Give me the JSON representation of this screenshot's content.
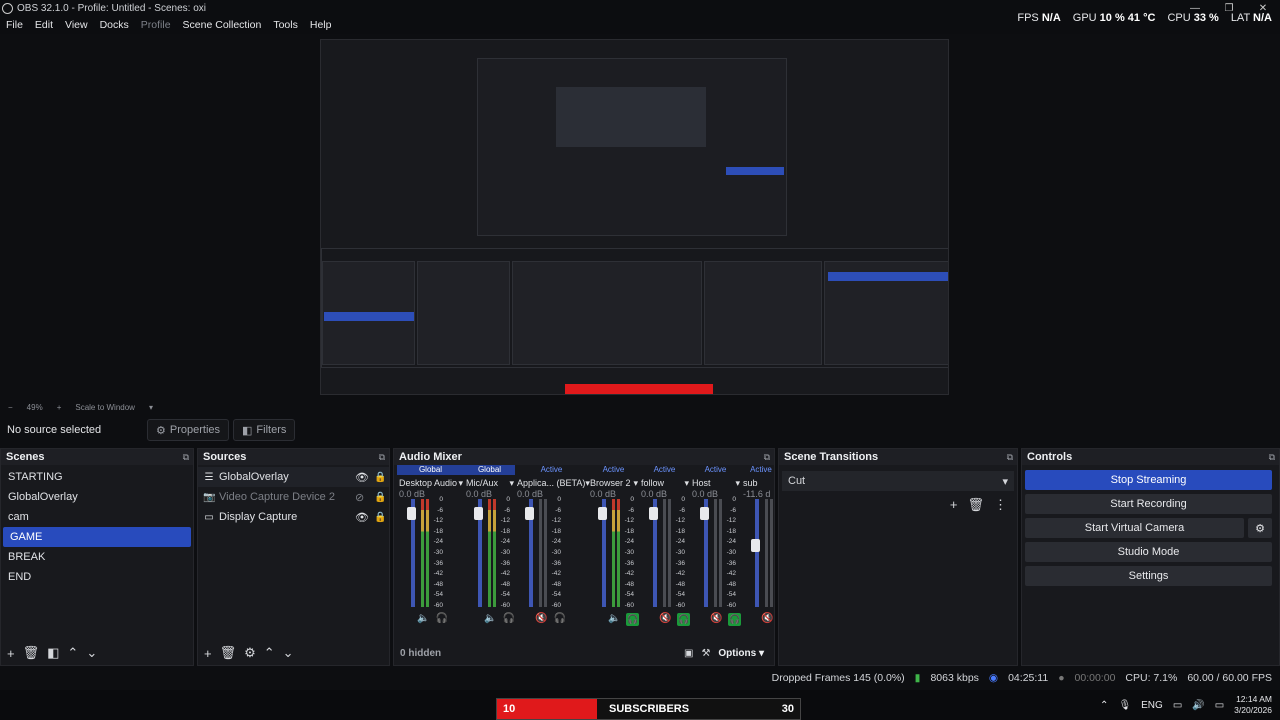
{
  "window": {
    "title": "OBS 32.1.0 - Profile: Untitled - Scenes: oxi"
  },
  "menu": [
    "File",
    "Edit",
    "View",
    "Docks",
    "Profile",
    "Scene Collection",
    "Tools",
    "Help"
  ],
  "stats": {
    "fps_label": "FPS",
    "fps_value": "N/A",
    "gpu_label": "GPU",
    "gpu_value": "10 % 41 °C",
    "cpu_label": "CPU",
    "cpu_value": "33 %",
    "lat_label": "LAT",
    "lat_value": "N/A"
  },
  "zoom": {
    "percent": "49%",
    "mode": "Scale to Window"
  },
  "props": {
    "no_source": "No source selected",
    "properties": "Properties",
    "filters": "Filters"
  },
  "scenes": {
    "title": "Scenes",
    "items": [
      "STARTING",
      "GlobalOverlay",
      "cam",
      "GAME",
      "BREAK",
      "END"
    ],
    "selected_index": 3
  },
  "sources": {
    "title": "Sources",
    "items": [
      {
        "name": "GlobalOverlay",
        "icon": "list-icon"
      },
      {
        "name": "Video Capture Device 2",
        "icon": "camera-icon"
      },
      {
        "name": "Display Capture",
        "icon": "monitor-icon"
      }
    ]
  },
  "mixer": {
    "title": "Audio Mixer",
    "hidden": "0 hidden",
    "options": "Options",
    "channels": [
      {
        "tag": "Global",
        "name": "Desktop Audio",
        "db": "0.0 dB",
        "level": 0.92,
        "active": true
      },
      {
        "tag": "Global",
        "name": "Mic/Aux",
        "db": "0.0 dB",
        "level": 0.92,
        "active": true
      },
      {
        "tag": "Active",
        "name": "Applica... (BETA)",
        "db": "0.0 dB",
        "level": 0.92,
        "active": false
      },
      {
        "tag": "Active",
        "name": "Browser 2",
        "db": "0.0 dB",
        "level": 0.92,
        "active": true
      },
      {
        "tag": "Active",
        "name": "follow",
        "db": "0.0 dB",
        "level": 0.92,
        "active": false
      },
      {
        "tag": "Active",
        "name": "Host",
        "db": "0.0 dB",
        "level": 0.92,
        "active": false
      },
      {
        "tag": "Active",
        "name": "sub",
        "db": "-11.6 d",
        "level": 0.6,
        "active": false
      }
    ],
    "scale": [
      "0",
      "-6",
      "-12",
      "-18",
      "-24",
      "-30",
      "-36",
      "-42",
      "-48",
      "-54",
      "-60"
    ]
  },
  "transitions": {
    "title": "Scene Transitions",
    "selected": "Cut"
  },
  "controls": {
    "title": "Controls",
    "stop_streaming": "Stop Streaming",
    "start_recording": "Start Recording",
    "virtual_camera": "Start Virtual Camera",
    "studio_mode": "Studio Mode",
    "settings": "Settings"
  },
  "status": {
    "dropped": "Dropped Frames 145 (0.0%)",
    "bitrate": "8063 kbps",
    "stream_time": "04:25:11",
    "rec_time": "00:00:00",
    "cpu": "CPU: 7.1%",
    "fps": "60.00 / 60.00 FPS"
  },
  "banner": {
    "left": "10",
    "text": "SUBSCRIBERS",
    "right": "30"
  },
  "tray": {
    "lang": "ENG",
    "time": "12:14 AM",
    "date": "3/20/2026"
  }
}
